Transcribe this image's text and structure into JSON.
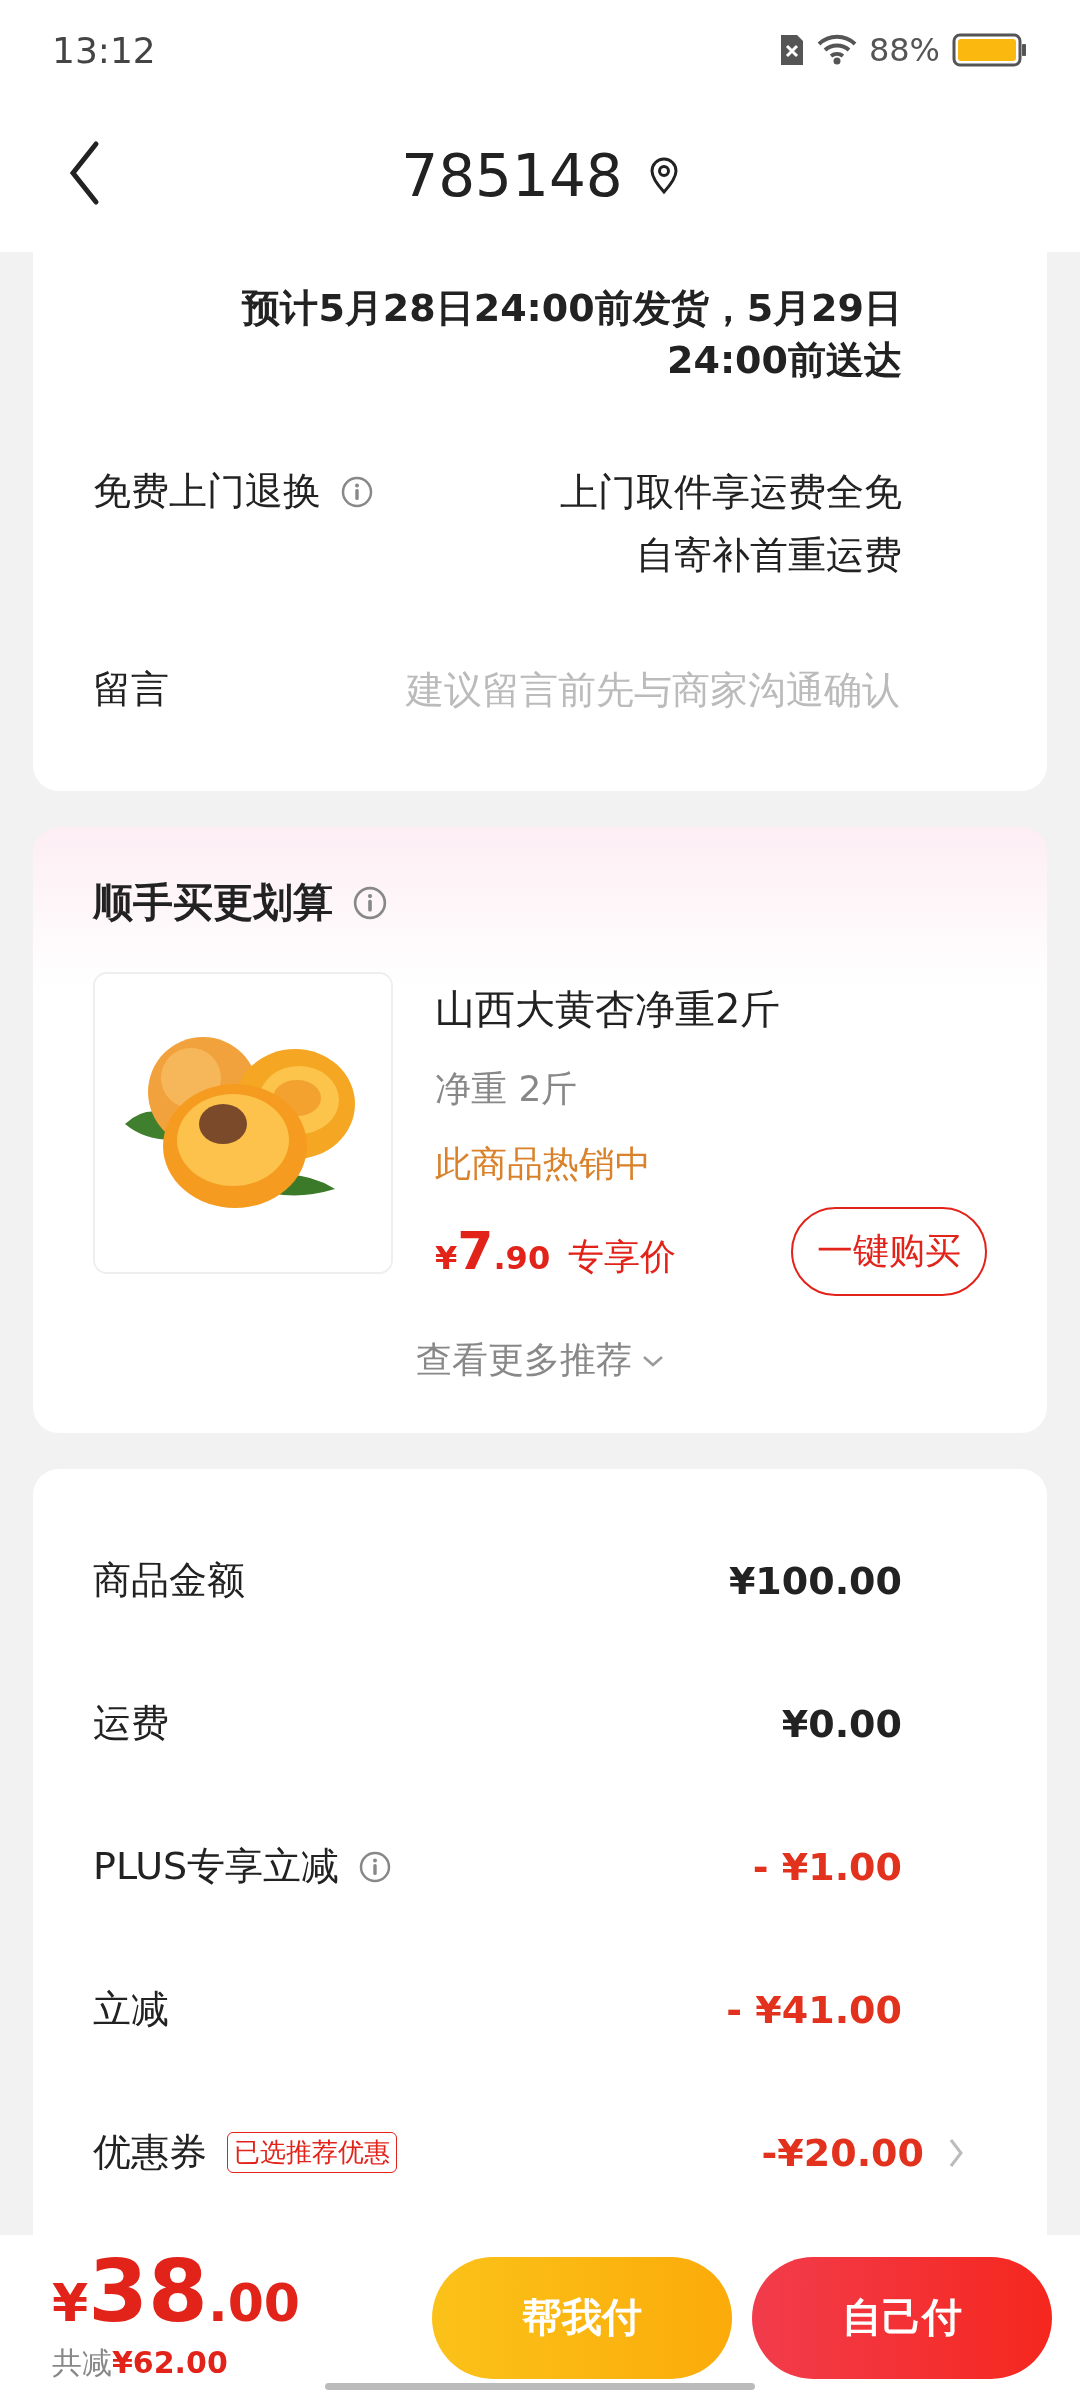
{
  "status_bar": {
    "time": "13:12",
    "battery": "88%"
  },
  "header": {
    "title": "785148"
  },
  "delivery": {
    "estimate_lines": [
      "预计5月28日24:00前发货，5月29日",
      "24:00前送达"
    ]
  },
  "return_service": {
    "label": "免费上门退换",
    "info": true,
    "value_lines": [
      "上门取件享运费全免",
      "自寄补首重运费"
    ]
  },
  "message": {
    "label": "留言",
    "placeholder": "建议留言前先与商家沟通确认"
  },
  "addon": {
    "title": "顺手买更划算",
    "info": true,
    "product": {
      "kind": "picture",
      "name": "山西大黄杏净重2斤",
      "spec": "净重 2斤",
      "hot_tag": "此商品热销中",
      "currency": "¥",
      "price_int": "7",
      "price_dec": ".90",
      "price_label": "专享价",
      "buy_button": "一键购买"
    },
    "more_link": "查看更多推荐"
  },
  "summary": [
    {
      "label": "商品金额",
      "value": "¥100.00",
      "kind": "plain",
      "info": false,
      "arrow": false
    },
    {
      "label": "运费",
      "value": "¥0.00",
      "kind": "plain",
      "info": false,
      "arrow": false
    },
    {
      "label": "PLUS专享立减",
      "value": "- ¥1.00",
      "kind": "discount",
      "info": true,
      "arrow": false
    },
    {
      "label": "立减",
      "value": "- ¥41.00",
      "kind": "discount",
      "info": false,
      "arrow": false
    },
    {
      "label": "优惠券",
      "tag": "已选推荐优惠",
      "value": "-¥20.00",
      "kind": "discount",
      "info": false,
      "arrow": true
    }
  ],
  "footer": {
    "currency": "¥",
    "total_int": "38",
    "total_dec": ".00",
    "saved_label": "共减",
    "saved_value": "¥62.00",
    "buttons": [
      {
        "label": "帮我付",
        "kind": "help"
      },
      {
        "label": "自己付",
        "kind": "self"
      }
    ]
  }
}
